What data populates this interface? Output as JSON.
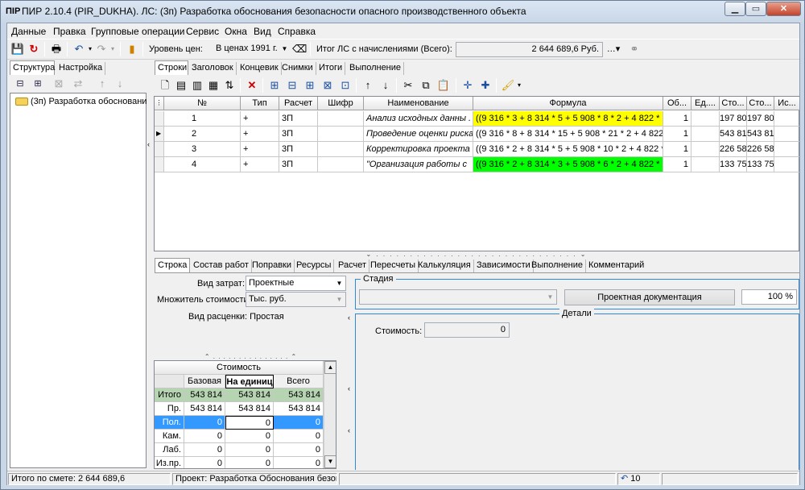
{
  "window": {
    "title": "ПИР 2.10.4 (PIR_DUKHA). ЛС: (3п) Разработка  обоснования безопасности опасного производственного объекта",
    "app_icon": "ПИР"
  },
  "menu": [
    "Данные",
    "Правка",
    "Групповые операции",
    "Сервис",
    "Окна",
    "Вид",
    "Справка"
  ],
  "toolbar": {
    "price_level_label": "Уровень цен:",
    "price_level_value": "В ценах 1991 г.",
    "total_label": "Итог ЛС с начислениями (Всего):",
    "total_value": "2 644 689,6 Руб."
  },
  "left_panel": {
    "tabs": [
      "Структура",
      "Настройка"
    ],
    "tree_item": "(3п) Разработка  обосновани"
  },
  "top_tabs": [
    "Строки",
    "Заголовок",
    "Концевик",
    "Снимки",
    "Итоги",
    "Выполнение"
  ],
  "grid": {
    "columns": [
      "№",
      "Тип",
      "Расчет",
      "Шифр",
      "Наименование",
      "Формула",
      "Об...",
      "Ед....",
      "Сто...",
      "Сто...",
      "Ис..."
    ],
    "rows": [
      {
        "num": "1",
        "type": "+",
        "calc": "3П",
        "code": "",
        "name": "Анализ исходных данны .",
        "formula": "((9 316 * 3 + 8 314 * 5 + 5 908 * 8 * 2 + 4 822 *",
        "qty": "1",
        "unit": "",
        "cost1": "197 80",
        "cost2": "197 80",
        "exec": "",
        "highlight": "#ffff00"
      },
      {
        "num": "2",
        "type": "+",
        "calc": "3П",
        "code": "",
        "name": "Проведение оценки риска",
        "formula": "((9 316 * 8 + 8 314 * 15 + 5 908 * 21 * 2 + 4 822 *",
        "qty": "1",
        "unit": "",
        "cost1": "543 81",
        "cost2": "543 81",
        "exec": "",
        "highlight": ""
      },
      {
        "num": "3",
        "type": "+",
        "calc": "3П",
        "code": "",
        "name": "Корректировка проекта ОБ",
        "formula": "((9 316 * 2 + 8 314 * 5 + 5 908 * 10 * 2 + 4 822 *",
        "qty": "1",
        "unit": "",
        "cost1": "226 58",
        "cost2": "226 58",
        "exec": "",
        "highlight": ""
      },
      {
        "num": "4",
        "type": "+",
        "calc": "3П",
        "code": "",
        "name": "\"Организация работы с",
        "formula": "((9 316 * 2 + 8 314 * 3 + 5 908 * 6 * 2 + 4 822 *",
        "qty": "1",
        "unit": "",
        "cost1": "133 75",
        "cost2": "133 75",
        "exec": "",
        "highlight": "#00ff00"
      }
    ]
  },
  "bottom_tabs": [
    "Строка",
    "Состав работ",
    "Поправки",
    "Ресурсы",
    "Расчет",
    "Пересчеты",
    "Калькуляция",
    "Зависимости",
    "Выполнение",
    "Комментарий"
  ],
  "form": {
    "cost_type_label": "Вид затрат:",
    "cost_type_value": "Проектные",
    "multiplier_label": "Множитель стоимости:",
    "multiplier_value": "Тыс. руб.",
    "pricing_label": "Вид расценки: Простая"
  },
  "stage": {
    "title": "Стадия",
    "combo_value": "",
    "doc_button": "Проектная документация",
    "percent": "100 %"
  },
  "details": {
    "title": "Детали",
    "cost_label": "Стоимость:",
    "cost_value": "0"
  },
  "cost_table": {
    "header": "Стоимость",
    "columns": [
      "Базовая",
      "На единиц",
      "Всего"
    ],
    "rows": [
      {
        "label": "Итого",
        "base": "543 814",
        "unit": "543 814",
        "total": "543 814"
      },
      {
        "label": "Пр.",
        "base": "543 814",
        "unit": "543 814",
        "total": "543 814"
      },
      {
        "label": "Пол.",
        "base": "0",
        "unit": "0",
        "total": "0"
      },
      {
        "label": "Кам.",
        "base": "0",
        "unit": "0",
        "total": "0"
      },
      {
        "label": "Лаб.",
        "base": "0",
        "unit": "0",
        "total": "0"
      },
      {
        "label": "Из.пр.",
        "base": "0",
        "unit": "0",
        "total": "0"
      }
    ]
  },
  "status": {
    "total": "Итого по смете: 2 644 689,6",
    "project": "Проект: Разработка Обоснования безопас",
    "undo_count": "10"
  }
}
